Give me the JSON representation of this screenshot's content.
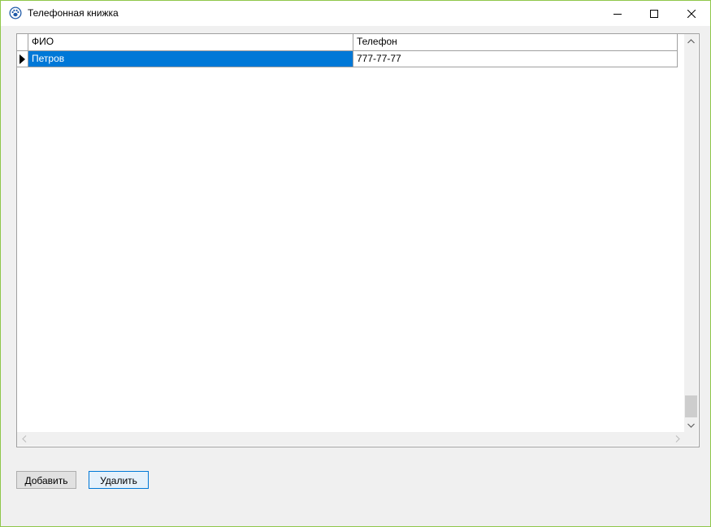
{
  "window": {
    "title": "Телефонная книжка",
    "icon": "paw-app-icon",
    "controls": [
      "minimize-icon",
      "maximize-icon",
      "close-icon"
    ]
  },
  "grid": {
    "columns": [
      "ФИО",
      "Телефон"
    ],
    "rows": [
      {
        "fio": "Петров",
        "phone": "777-77-77",
        "selected": true
      }
    ],
    "selection_color": "#0078d7"
  },
  "buttons": {
    "add_label": "Добавить",
    "delete_label": "Удалить"
  },
  "colors": {
    "window_border": "#8fc74a",
    "focus_border": "#0078d7"
  }
}
